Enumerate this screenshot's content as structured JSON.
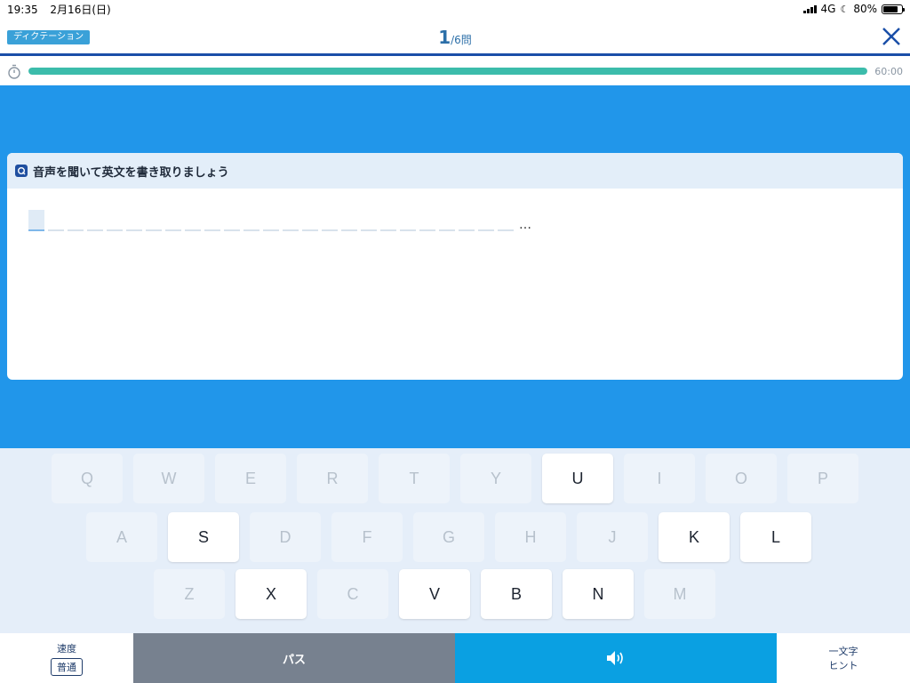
{
  "status": {
    "time": "19:35",
    "date": "2月16日(日)",
    "network": "4G",
    "battery": "80%",
    "battery_level": 0.8
  },
  "header": {
    "mode_badge": "ディクテーション",
    "current": "1",
    "total": "/6問",
    "close_icon": "close-icon"
  },
  "timer": {
    "progress": 1.0,
    "text": "60:00"
  },
  "question": {
    "title": "音声を聞いて英文を書き取りましょう",
    "slot_count": 25,
    "ellipsis": "…"
  },
  "keyboard": {
    "rows": [
      [
        {
          "label": "Q",
          "enabled": false
        },
        {
          "label": "W",
          "enabled": false
        },
        {
          "label": "E",
          "enabled": false
        },
        {
          "label": "R",
          "enabled": false
        },
        {
          "label": "T",
          "enabled": false
        },
        {
          "label": "Y",
          "enabled": false
        },
        {
          "label": "U",
          "enabled": true
        },
        {
          "label": "I",
          "enabled": false
        },
        {
          "label": "O",
          "enabled": false
        },
        {
          "label": "P",
          "enabled": false
        }
      ],
      [
        {
          "label": "A",
          "enabled": false
        },
        {
          "label": "S",
          "enabled": true
        },
        {
          "label": "D",
          "enabled": false
        },
        {
          "label": "F",
          "enabled": false
        },
        {
          "label": "G",
          "enabled": false
        },
        {
          "label": "H",
          "enabled": false
        },
        {
          "label": "J",
          "enabled": false
        },
        {
          "label": "K",
          "enabled": true
        },
        {
          "label": "L",
          "enabled": true
        }
      ],
      [
        {
          "label": "Z",
          "enabled": false
        },
        {
          "label": "X",
          "enabled": true
        },
        {
          "label": "C",
          "enabled": false
        },
        {
          "label": "V",
          "enabled": true
        },
        {
          "label": "B",
          "enabled": true
        },
        {
          "label": "N",
          "enabled": true
        },
        {
          "label": "M",
          "enabled": false
        }
      ]
    ]
  },
  "toolbar": {
    "speed_label": "速度",
    "speed_value": "普通",
    "pass_label": "パス",
    "audio_icon": "speaker-icon",
    "hint_line1": "一文字",
    "hint_line2": "ヒント"
  }
}
